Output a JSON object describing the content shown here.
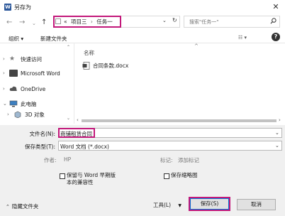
{
  "window": {
    "title": "另存为",
    "app_icon": "word-icon"
  },
  "address": {
    "prefix": "«",
    "path": [
      "项目三",
      "任务一"
    ],
    "separator": "›",
    "search_placeholder": "搜索\"任务一\""
  },
  "toolbar": {
    "organize": "组织 ▾",
    "new_folder": "新建文件夹",
    "view": "☷ ▾"
  },
  "sidebar": {
    "items": [
      {
        "label": "快速访问",
        "icon": "star-icon"
      },
      {
        "label": "Microsoft Word",
        "icon": "word-icon"
      },
      {
        "label": "OneDrive",
        "icon": "cloud-icon"
      },
      {
        "label": "此电脑",
        "icon": "computer-icon"
      },
      {
        "label": "3D 对象",
        "icon": "cube-icon"
      }
    ]
  },
  "file_list": {
    "column_name": "名称",
    "files": [
      {
        "name": "合同条款.docx",
        "icon": "docx-icon"
      }
    ]
  },
  "form": {
    "filename_label": "文件名(N):",
    "filename_value": "商铺租赁合同",
    "savetype_label": "保存类型(T):",
    "savetype_value": "Word 文档 (*.docx)",
    "author_label": "作者:",
    "author_value": "HP",
    "tags_label": "标记:",
    "tags_value": "添加标记",
    "compat_label": "保留与 Word 早期版",
    "compat_label_2": "本的兼容性",
    "thumbnail_label": "保存缩略图"
  },
  "footer": {
    "hide_folders": "隐藏文件夹",
    "tools": "工具(L)",
    "save": "保存(S)",
    "cancel": "取消"
  },
  "colors": {
    "highlight": "#c2187a",
    "accent": "#0078d7"
  }
}
